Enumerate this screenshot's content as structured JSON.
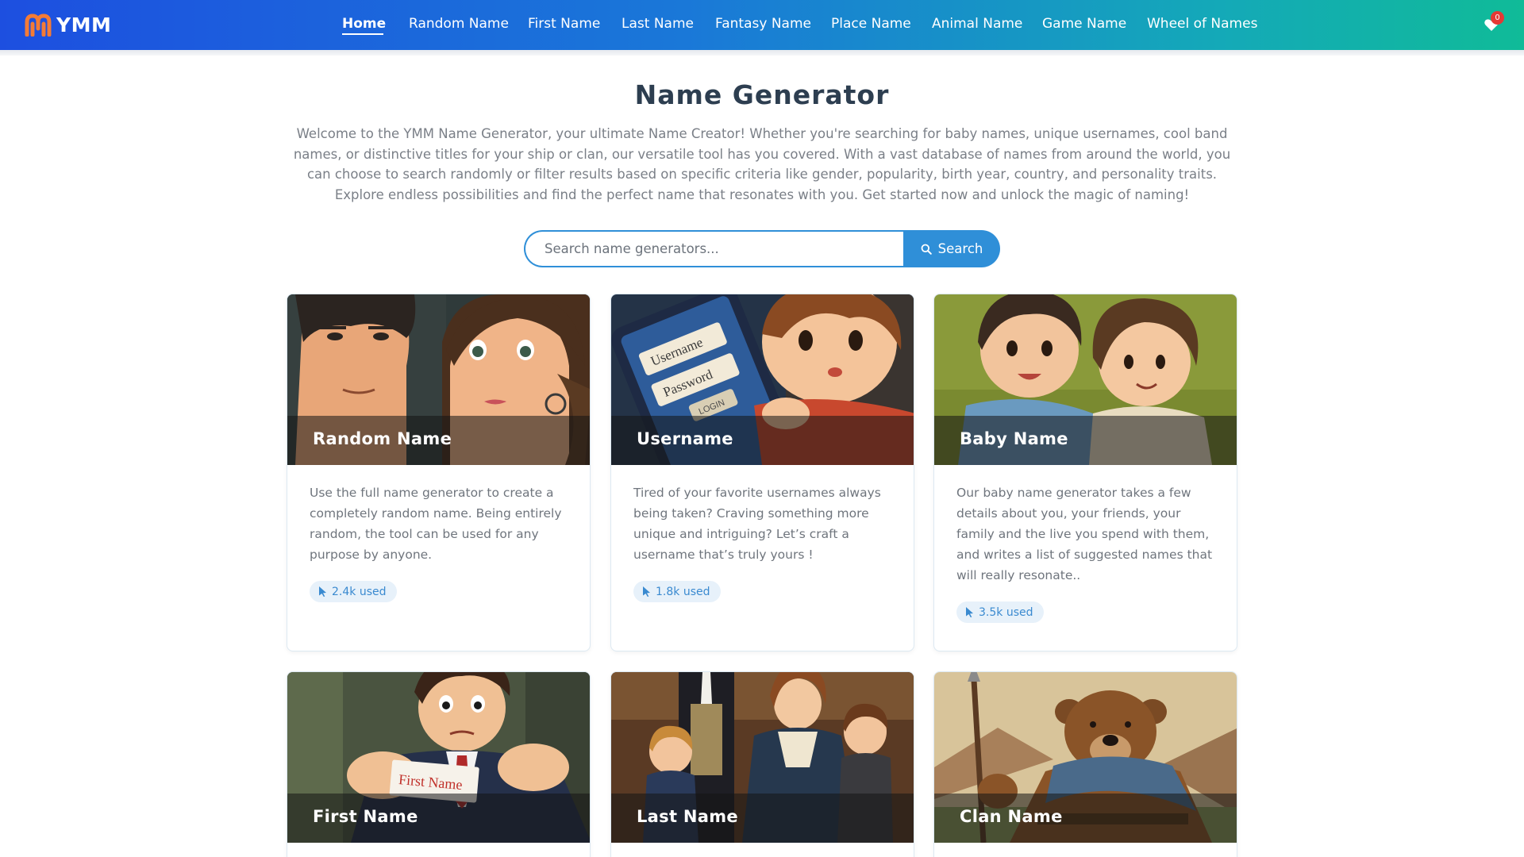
{
  "header": {
    "brand": "YMM",
    "nav": [
      {
        "label": "Home",
        "active": true
      },
      {
        "label": "Random Name"
      },
      {
        "label": "First Name"
      },
      {
        "label": "Last Name"
      },
      {
        "label": "Fantasy Name"
      },
      {
        "label": "Place Name"
      },
      {
        "label": "Animal Name"
      },
      {
        "label": "Game Name"
      },
      {
        "label": "Wheel of Names"
      }
    ],
    "cart_count": "0",
    "icons": {
      "cart": "heart-cart-icon",
      "logo": "ymm-logo-icon"
    }
  },
  "hero": {
    "title": "Name Generator",
    "intro": "Welcome to the YMM Name Generator, your ultimate Name Creator! Whether you're searching for baby names, unique usernames, cool band names, or distinctive titles for your ship or clan, our versatile tool has you covered. With a vast database of names from around the world, you can choose to search randomly or filter results based on specific criteria like gender, popularity, birth year, country, and personality traits. Explore endless possibilities and find the perfect name that resonates with you. Get started now and unlock the magic of naming!"
  },
  "search": {
    "placeholder": "Search name generators...",
    "value": "",
    "button_label": "Search",
    "icon": "search-icon"
  },
  "cards": [
    {
      "title": "Random Name",
      "desc": "Use the full name generator to create a completely random name. Being entirely random, the tool can be used for any purpose by anyone.",
      "usage": "2.4k used"
    },
    {
      "title": "Username",
      "desc": "Tired of your favorite usernames always being taken? Craving something more unique and intriguing? Let’s craft a username that’s truly yours !",
      "usage": "1.8k used"
    },
    {
      "title": "Baby Name",
      "desc": "Our baby name generator takes a few details about you, your friends, your family and the live you spend with them, and writes a list of suggested names that will really resonate..",
      "usage": "3.5k used"
    },
    {
      "title": "First Name",
      "desc": "",
      "usage": ""
    },
    {
      "title": "Last Name",
      "desc": "",
      "usage": ""
    },
    {
      "title": "Clan Name",
      "desc": "",
      "usage": ""
    }
  ],
  "illustration_text": {
    "username_field": "Username",
    "password_field": "Password",
    "login_button": "LOGIN",
    "first_name_card": "First Name"
  },
  "colors": {
    "accent": "#2f8fd8",
    "header_gradient": [
      "#1d4fe0",
      "#10bb98"
    ],
    "badge_bg": "#e7f1fa",
    "cart_badge": "#e53935"
  }
}
